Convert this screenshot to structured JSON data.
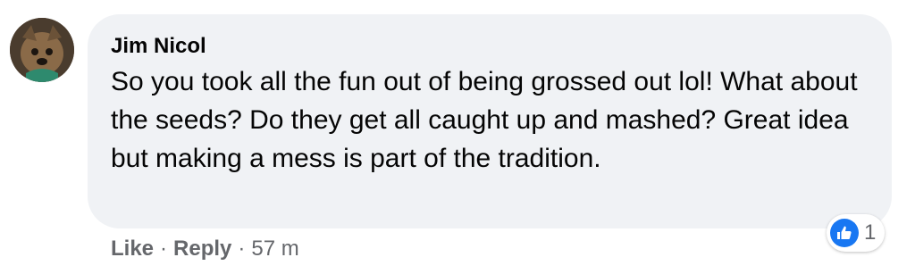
{
  "comment": {
    "author": "Jim Nicol",
    "text": "So you took all the fun out of being grossed out lol! What about the seeds? Do they get all caught up and mashed? Great idea but making a mess is part of the tradition."
  },
  "reactions": {
    "icon": "like-icon",
    "count": "1",
    "badge_color": "#1877f2"
  },
  "actions": {
    "like_label": "Like",
    "separator": "·",
    "reply_label": "Reply",
    "timestamp": "57 m"
  },
  "colors": {
    "bubble": "#f0f2f5",
    "secondary_text": "#65676b",
    "primary_text": "#050505"
  }
}
